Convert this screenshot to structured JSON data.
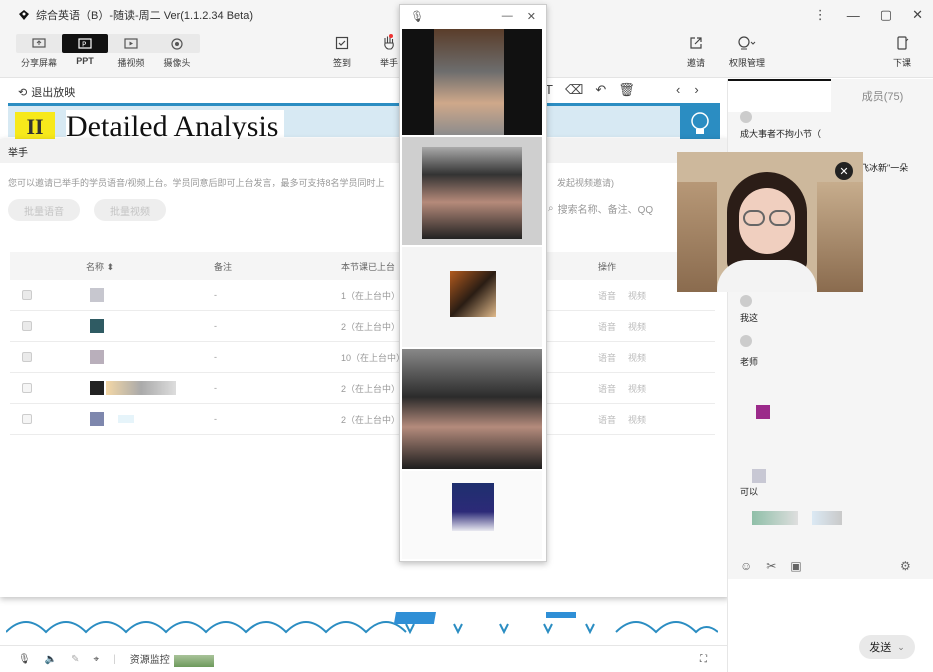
{
  "window": {
    "title": "综合英语（B）-随读-周二 Ver(1.1.2.34 Beta)",
    "controls": [
      "⋮",
      "—",
      "▢",
      "✕"
    ]
  },
  "toolbar": {
    "modes": [
      "分享屏幕",
      "PPT",
      "播视频",
      "摄像头"
    ],
    "active_mode": "PPT",
    "signin": "签到",
    "raise_hand": "举手",
    "invite": "邀请",
    "permissions": "权限管理",
    "leave": "下课"
  },
  "stage": {
    "exit_label": "退出放映",
    "slide_number": "II",
    "slide_heading": "Detailed Analysis"
  },
  "bottombar": {
    "resource_label": "资源监控"
  },
  "dialog": {
    "title": "举手",
    "tip": "您可以邀请已举手的学员语音/视频上台。学员同意后即可上台发言，最多可支持8名学员同时上",
    "tip_tail": "发起视频邀请)",
    "btn_voice": "批量语音",
    "btn_video": "批量视频",
    "search_placeholder": "搜索名称、备注、QQ",
    "columns": {
      "name": "名称 ⬍",
      "note": "备注",
      "times": "本节课已上台",
      "ops": "操作"
    },
    "rows": [
      {
        "note": "-",
        "times": "1（在上台中）",
        "voice": "语音",
        "video": "视频",
        "checked": true
      },
      {
        "note": "-",
        "times": "2（在上台中）",
        "voice": "语音",
        "video": "视频",
        "checked": true
      },
      {
        "note": "-",
        "times": "10（在上台中）",
        "voice": "语音",
        "video": "视频",
        "checked": true
      },
      {
        "note": "-",
        "times": "2（在上台中）",
        "voice": "语音",
        "video": "视频",
        "checked": false
      },
      {
        "note": "-",
        "times": "2（在上台中）",
        "voice": "语音",
        "video": "视频",
        "checked": false
      }
    ]
  },
  "video_popup": {
    "controls": [
      "—",
      "✕"
    ]
  },
  "right_panel": {
    "tab_chat": "",
    "tab_members": "成员(75)",
    "messages": [
      {
        "text": "成大事者不拘小节（"
      },
      {
        "text": "飞冰新\"一朵"
      },
      {
        "text": "我这"
      },
      {
        "text": "老师"
      },
      {
        "text": "可以"
      }
    ],
    "send_label": "发送"
  },
  "colors": {
    "accent_dark": "#111111",
    "slide_blue": "#2b8dc2",
    "slide_yellow": "#f7e91b",
    "record_red": "#e33333"
  }
}
